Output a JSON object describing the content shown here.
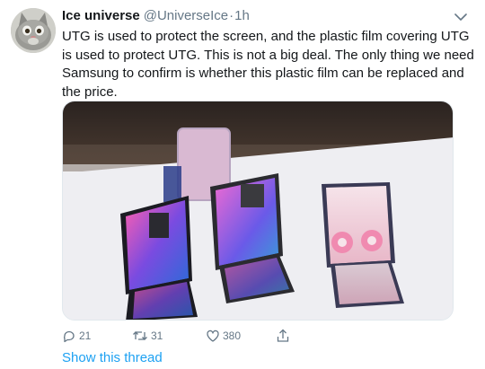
{
  "tweet": {
    "author": {
      "name": "Ice universe",
      "handle": "@UniverseIce",
      "time": "1h"
    },
    "separator": "·",
    "text": "UTG is used to protect the screen, and the plastic film covering UTG is used to protect UTG. This is not a big deal. The only thing we need Samsung to confirm is whether this plastic film can be replaced and the price.",
    "actions": {
      "reply_count": "21",
      "retweet_count": "31",
      "like_count": "380"
    },
    "thread_link": "Show this thread"
  },
  "icons": {
    "avatar": "cat-avatar",
    "caret": "chevron-down-icon",
    "reply": "reply-icon",
    "retweet": "retweet-icon",
    "like": "heart-icon",
    "share": "share-icon"
  },
  "colors": {
    "text": "#14171a",
    "secondary": "#657786",
    "link": "#1da1f2"
  }
}
